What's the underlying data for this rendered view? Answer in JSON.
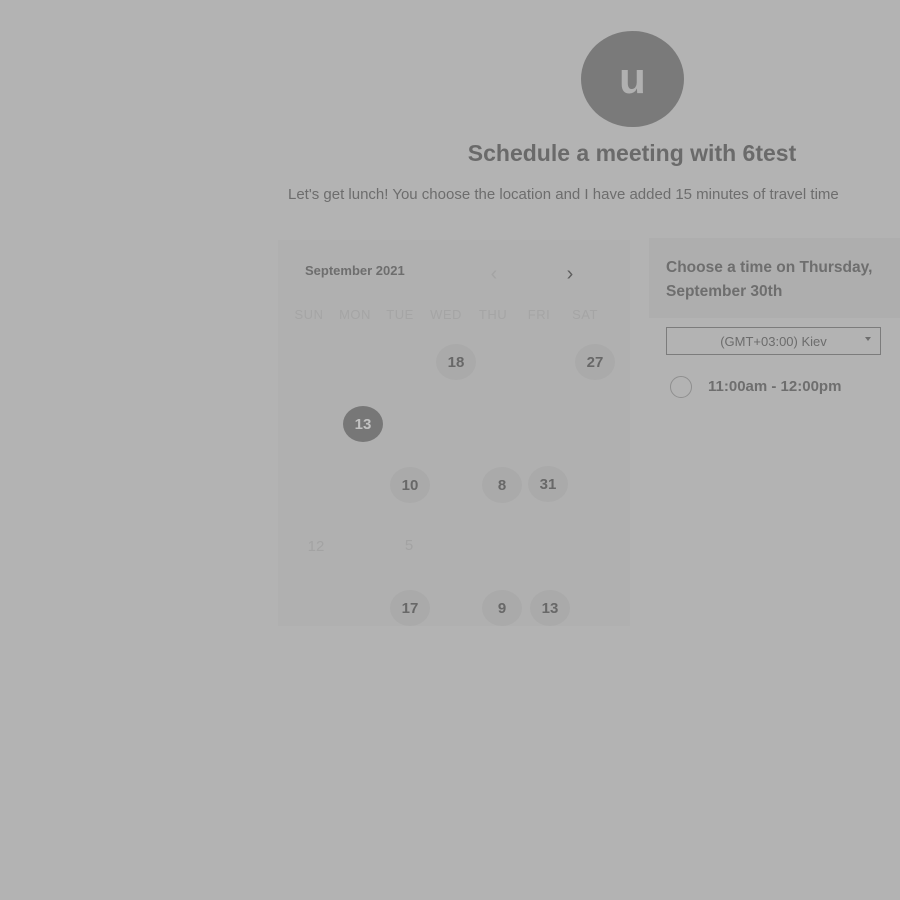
{
  "header": {
    "avatar_initial": "u",
    "title": "Schedule a meeting with 6test",
    "subtitle": "Let's get lunch! You choose the location and I have added 15 minutes of travel time"
  },
  "calendar": {
    "month_label": "September 2021",
    "weekdays": [
      "SUN",
      "MON",
      "TUE",
      "WED",
      "THU",
      "FRI",
      "SAT"
    ],
    "days": [
      {
        "label": "18",
        "state": "available"
      },
      {
        "label": "27",
        "state": "available"
      },
      {
        "label": "13",
        "state": "selected"
      },
      {
        "label": "10",
        "state": "available"
      },
      {
        "label": "8",
        "state": "available"
      },
      {
        "label": "31",
        "state": "available"
      },
      {
        "label": "12",
        "state": "unavailable"
      },
      {
        "label": "5",
        "state": "unavailable"
      },
      {
        "label": "17",
        "state": "available"
      },
      {
        "label": "9",
        "state": "available"
      },
      {
        "label": "13",
        "state": "available"
      }
    ]
  },
  "time_picker": {
    "heading": "Choose a time on Thursday, September 30th",
    "timezone": "(GMT+03:00) Kiev",
    "slots": [
      {
        "label": "11:00am - 12:00pm"
      }
    ]
  },
  "colors": {
    "background": "#b3b3b3",
    "selected_day": "#777777",
    "available_day": "#aaaaaa"
  },
  "icons": {
    "prev": "chevron-left-icon",
    "next": "chevron-right-icon",
    "timezone_caret": "caret-down-icon"
  }
}
